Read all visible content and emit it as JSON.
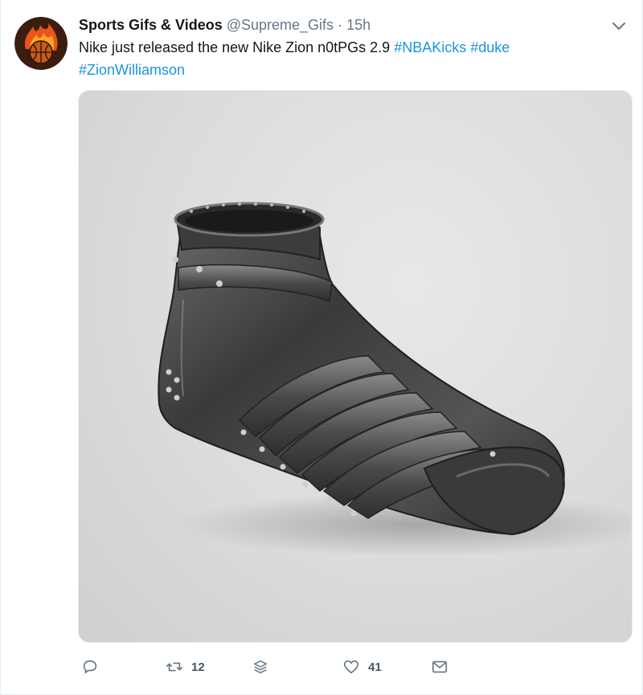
{
  "tweet": {
    "author_name": "Sports Gifs & Videos",
    "handle": "@Supreme_Gifs",
    "separator": "·",
    "time": "15h",
    "text_plain": "Nike just released the new Nike Zion n0tPGs 2.9",
    "hashtags": [
      "#NBAKicks",
      "#duke",
      "#ZionWilliamson"
    ],
    "icons": {
      "avatar": "basketball-fire-avatar",
      "caret": "chevron-down-icon",
      "media": "armor-shoe-photo"
    }
  },
  "actions": {
    "reply": {
      "icon": "reply-icon",
      "count": ""
    },
    "retweet": {
      "icon": "retweet-icon",
      "count": "12"
    },
    "stack": {
      "icon": "layers-icon",
      "count": ""
    },
    "like": {
      "icon": "heart-icon",
      "count": "41"
    },
    "message": {
      "icon": "envelope-icon",
      "count": ""
    }
  },
  "colors": {
    "link": "#1b95e0",
    "muted": "#657786",
    "text": "#14171a",
    "border": "#e6ecf0"
  }
}
